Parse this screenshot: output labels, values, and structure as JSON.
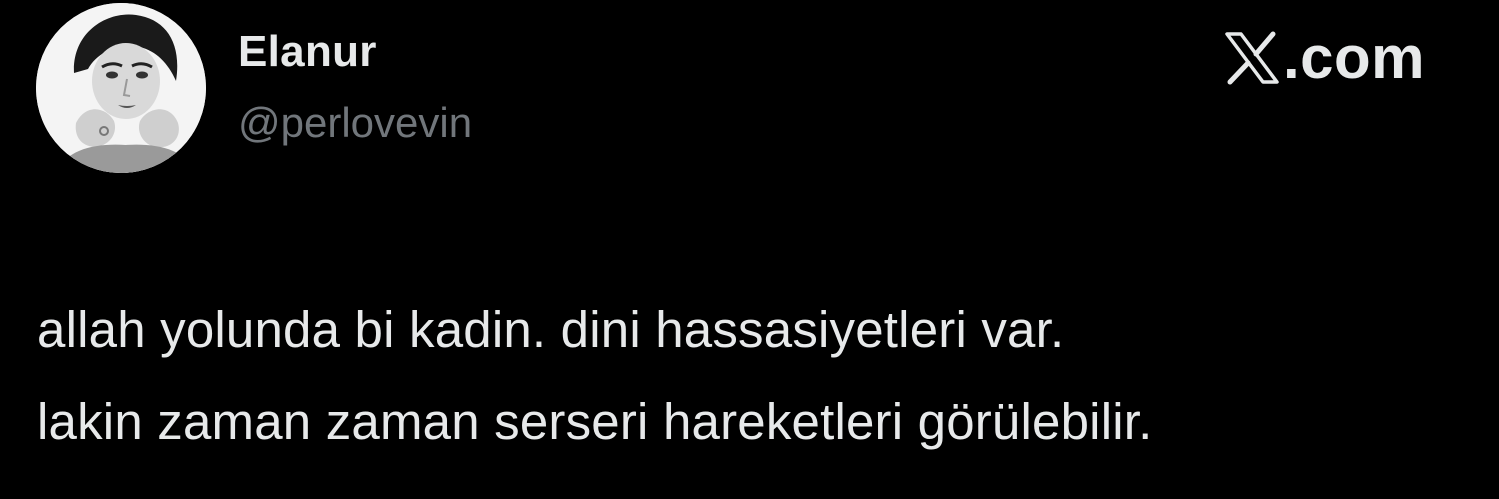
{
  "user": {
    "display_name": "Elanur",
    "handle": "@perlovevin",
    "avatar_icon": "avatar-portrait-icon"
  },
  "brand": {
    "label": ".com",
    "icon": "x-logo-icon"
  },
  "tweet": {
    "lines": [
      "allah yolunda bi kadin. dini hassasiyetleri var.",
      "lakin zaman zaman serseri hareketleri görülebilir."
    ]
  },
  "colors": {
    "background": "#000000",
    "primary_text": "#e7e9ea",
    "secondary_text": "#71767b"
  }
}
